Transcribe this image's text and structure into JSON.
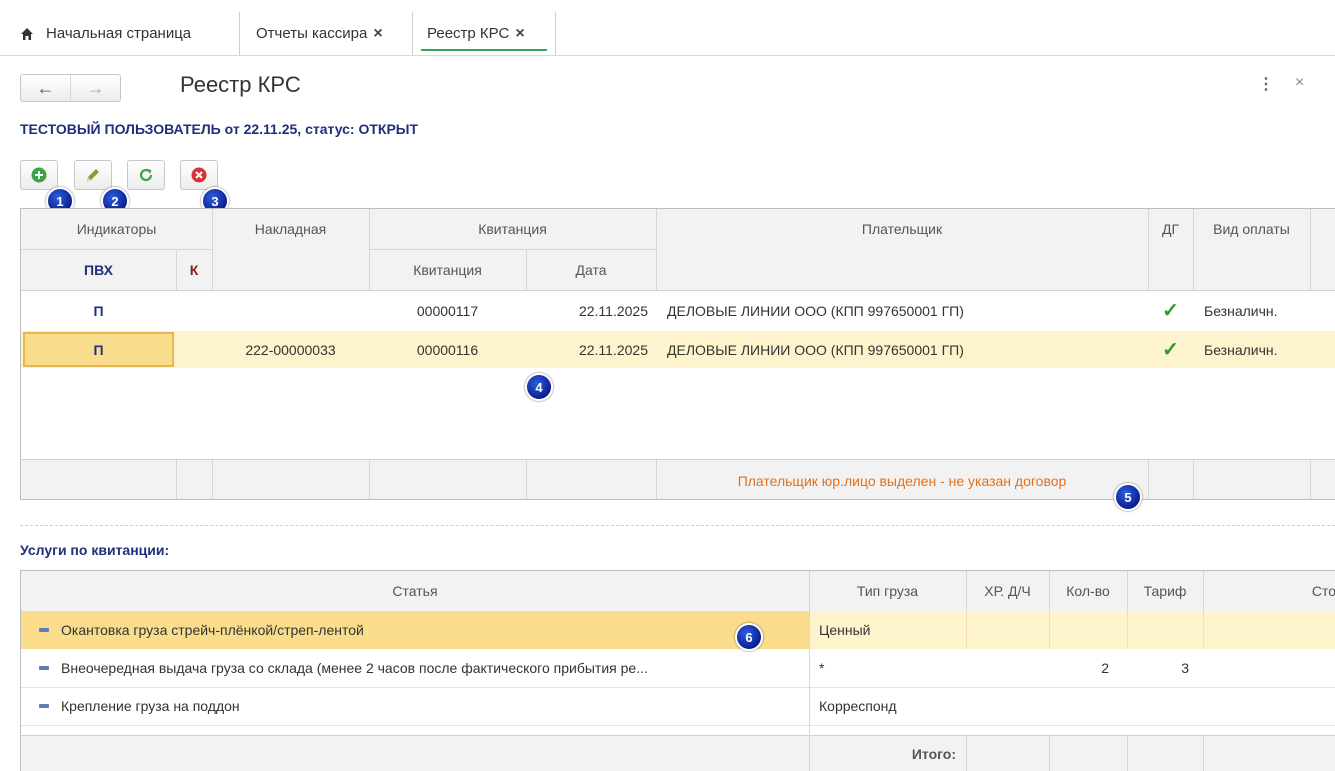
{
  "tabs": {
    "home": "Начальная страница",
    "cashier_reports": "Отчеты кассира",
    "registry": "Реестр КРС",
    "close": "×"
  },
  "header": {
    "back": "←",
    "forward": "→",
    "title": "Реестр КРС",
    "more": "⋮",
    "close": "×",
    "subtitle": "ТЕСТОВЫЙ ПОЛЬЗОВАТЕЛЬ от 22.11.25, статус: ОТКРЫТ"
  },
  "badges": [
    "1",
    "2",
    "3",
    "4",
    "5",
    "6"
  ],
  "grid": {
    "headers": {
      "indicators": "Индикаторы",
      "pvx": "ПВХ",
      "k": "К",
      "invoice": "Накладная",
      "receipt_group": "Квитанция",
      "receipt": "Квитанция",
      "date": "Дата",
      "payer": "Плательщик",
      "dg": "ДГ",
      "payment_type": "Вид оплаты"
    },
    "rows": [
      {
        "pvx": "П",
        "k": "",
        "invoice": "",
        "receipt": "00000117",
        "date": "22.11.2025",
        "payer": "ДЕЛОВЫЕ ЛИНИИ ООО (КПП 997650001 ГП)",
        "dg": "✓",
        "payment_type": "Безналичн."
      },
      {
        "pvx": "П",
        "k": "",
        "invoice": "222-00000033",
        "receipt": "00000116",
        "date": "22.11.2025",
        "payer": "ДЕЛОВЫЕ ЛИНИИ ООО (КПП 997650001 ГП)",
        "dg": "✓",
        "payment_type": "Безналичн."
      }
    ],
    "footer_warning": "Плательщик юр.лицо выделен - не указан договор"
  },
  "services": {
    "title": "Услуги по квитанции:",
    "headers": {
      "item": "Статья",
      "cargo_type": "Тип груза",
      "xr": "ХР. Д/Ч",
      "qty": "Кол-во",
      "tariff": "Тариф",
      "cost": "Сто"
    },
    "rows": [
      {
        "item": "Окантовка груза стрейч-плёнкой/стреп-лентой",
        "cargo_type": "Ценный",
        "xr": "",
        "qty": "",
        "tariff": ""
      },
      {
        "item": "Внеочередная выдача груза со склада (менее 2 часов после фактического прибытия ре...",
        "cargo_type": "*",
        "xr": "",
        "qty": "2",
        "tariff": "3"
      },
      {
        "item": "Крепление груза на поддон",
        "cargo_type": "Корреспонд",
        "xr": "",
        "qty": "",
        "tariff": ""
      }
    ],
    "total_label": "Итого:"
  },
  "colors": {
    "accent_text": "#1f2f7a",
    "selected_row": "#fdf3cd",
    "selected_cell": "#f9dd8c",
    "warning": "#e2711d",
    "check": "#2e9b2e",
    "active_tab_line": "#3aa35a"
  }
}
